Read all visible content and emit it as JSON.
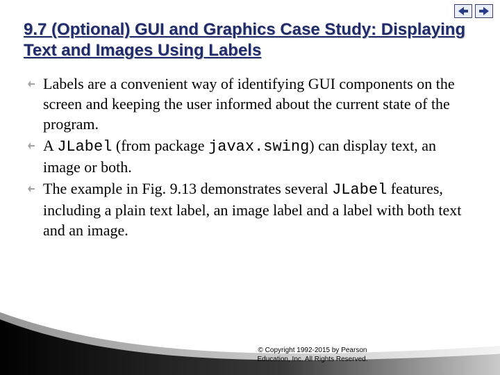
{
  "nav": {
    "prev_icon": "prev-arrow-icon",
    "next_icon": "next-arrow-icon"
  },
  "title": "9.7  (Optional) GUI and Graphics Case Study: Displaying Text and Images Using Labels",
  "bullets": [
    {
      "pre": "Labels are a convenient way of identifying GUI components on the screen and keeping the user informed about the current state of the program."
    },
    {
      "pre": "A ",
      "code1": "JLabel",
      "mid": " (from package ",
      "code2": "javax.swing",
      "post": ") can display text, an image or both."
    },
    {
      "pre": "The example in Fig. 9.13 demonstrates several ",
      "code1": "JLabel",
      "post": " features, including a plain text label, an image label and a label with both text and an image."
    }
  ],
  "copyright_line1": "© Copyright 1992-2015 by Pearson",
  "copyright_line2": "Education, Inc. All Rights Reserved."
}
